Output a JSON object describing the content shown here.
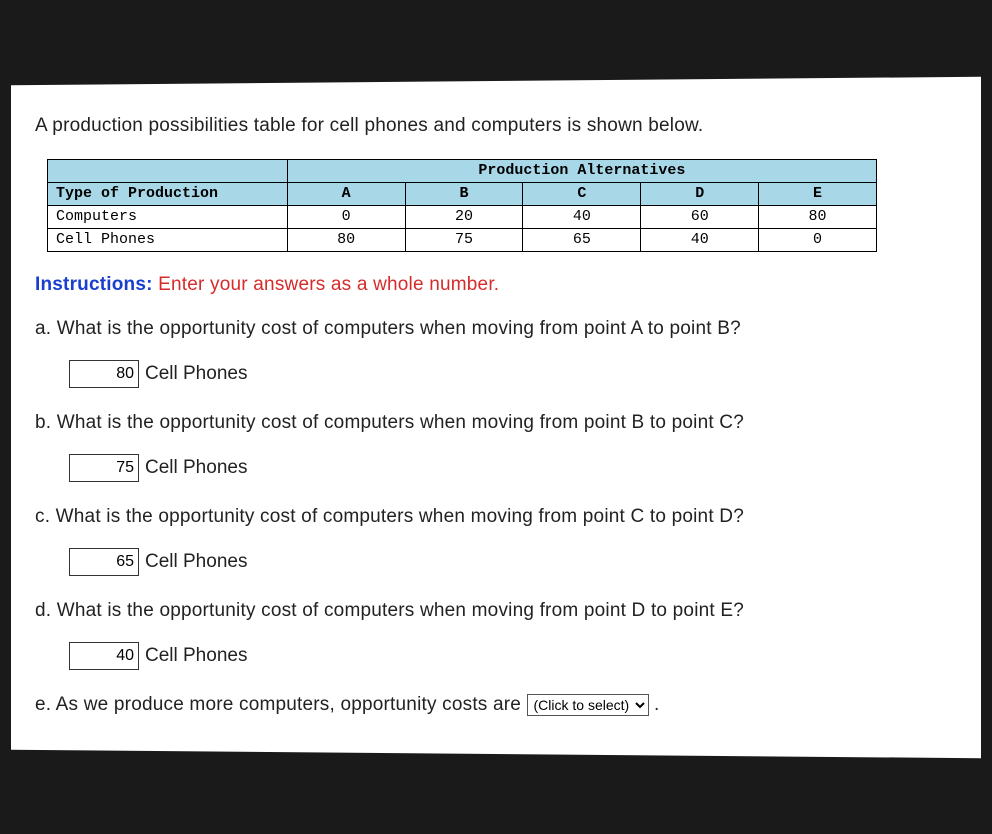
{
  "intro": "A production possibilities table for cell phones and computers is shown below.",
  "table": {
    "corner": "Type of Production",
    "header_span": "Production Alternatives",
    "cols": [
      "A",
      "B",
      "C",
      "D",
      "E"
    ],
    "rows": [
      {
        "label": "Computers",
        "values": [
          "0",
          "20",
          "40",
          "60",
          "80"
        ]
      },
      {
        "label": "Cell Phones",
        "values": [
          "80",
          "75",
          "65",
          "40",
          "0"
        ]
      }
    ]
  },
  "instructions": {
    "label": "Instructions:",
    "text": "Enter your answers as a whole number."
  },
  "questions": {
    "a": {
      "text": "a. What is the opportunity cost of computers when moving from point A to point B?",
      "value": "80",
      "unit": "Cell Phones"
    },
    "b": {
      "text": "b. What is the opportunity cost of computers when moving from point B to point C?",
      "value": "75",
      "unit": "Cell Phones"
    },
    "c": {
      "text": "c. What is the opportunity cost of computers when moving from point C to point D?",
      "value": "65",
      "unit": "Cell Phones"
    },
    "d": {
      "text": "d. What is the opportunity cost of computers when moving from point D to point E?",
      "value": "40",
      "unit": "Cell Phones"
    },
    "e": {
      "prefix": "e. As we produce more computers, opportunity costs are ",
      "select_placeholder": "(Click to select)",
      "suffix": " ."
    }
  }
}
